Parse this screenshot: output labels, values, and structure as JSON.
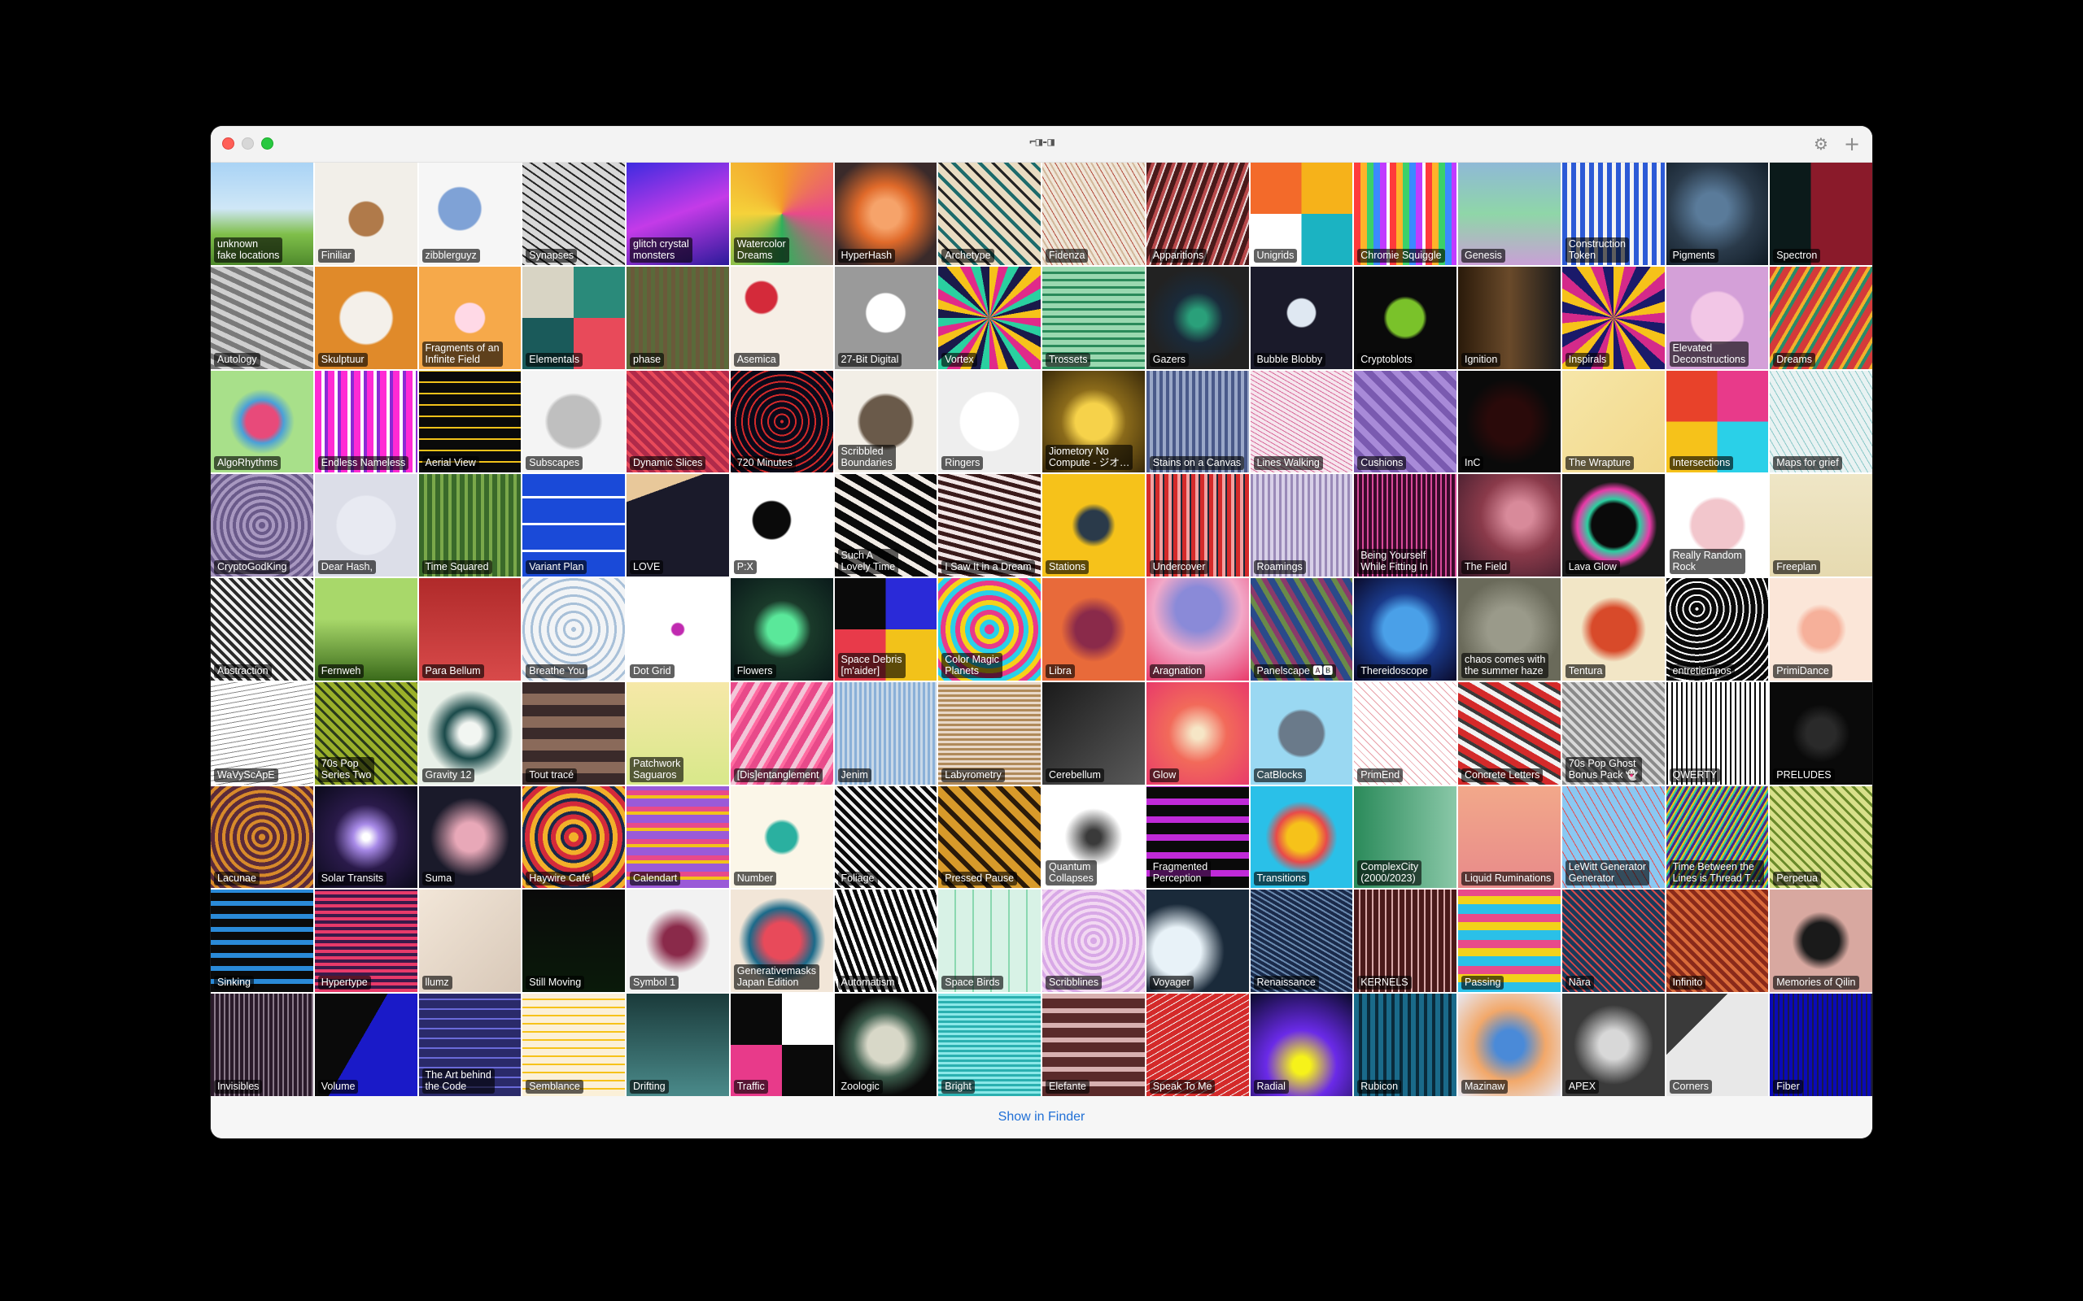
{
  "window": {
    "title_logo": "⌐◨-◨"
  },
  "toolbar": {
    "settings_icon": "⚙",
    "add_icon": "+"
  },
  "footer": {
    "show_in_finder": "Show in Finder"
  },
  "tiles": [
    {
      "label": "unknown\nfake locations",
      "bg": "linear-gradient(180deg,#a9d3f5 0%,#cfe7f7 45%,#7fbf4a 70%,#4f8a2c 100%)"
    },
    {
      "label": "Finiliar",
      "bg": "radial-gradient(circle at 50% 55%,#b07a4a 0 22%,#f2efe9 24%)"
    },
    {
      "label": "zibblerguyz",
      "bg": "radial-gradient(circle at 40% 45%,#7fa2d6 0 25%,#f6f6f6 27%)"
    },
    {
      "label": "Synapses",
      "bg": "repeating-linear-gradient(35deg,#222 0 2px,#d8d8d8 2px 9px)"
    },
    {
      "label": "glitch crystal\nmonsters",
      "bg": "linear-gradient(160deg,#3d2be0,#c43be8 50%,#2a1a9a)"
    },
    {
      "label": "Watercolor\nDreams",
      "bg": "conic-gradient(#f39b2a,#e84a8a,#2fb05a,#f5d23a,#f39b2a)"
    },
    {
      "label": "HyperHash",
      "bg": "radial-gradient(circle,#f6a36a 0 20%,#e06a2a 40%,#3a2a2a 80%)"
    },
    {
      "label": "Archetype",
      "bg": "repeating-linear-gradient(45deg,#e9dcc2 0 8px,#1c6b6b 8px 12px,#e9dcc2 12px 20px,#222 20px 23px)"
    },
    {
      "label": "Fidenza",
      "bg": "repeating-linear-gradient(60deg,#efe6d8 0 4px,#d2b79a 4px 6px,#efe6d8 6px 10px,#b04a3a 10px 11px)"
    },
    {
      "label": "Apparitions",
      "bg": "repeating-linear-gradient(110deg,#4a1a1a 0 6px,#b8484a 6px 10px,#e8d8d8 10px 12px)"
    },
    {
      "label": "Unigrids",
      "bg": "conic-gradient(#f6b21a 0 25%,#1bb3c2 0 50%,#ffffff 0 75%,#f36a2a 0)"
    },
    {
      "label": "Chromie Squiggle",
      "bg": "repeating-linear-gradient(90deg,#ff3b3b 0 8px,#ffb32a 8px 16px,#3bd16a 16px 24px,#3b8aff 24px 32px,#c13bff 32px 40px,#ffffff 40px 44px)"
    },
    {
      "label": "Genesis",
      "bg": "linear-gradient(180deg,#8fb9d6,#8fd6a8 50%,#c9a0d6)"
    },
    {
      "label": "Construction\nToken",
      "bg": "repeating-linear-gradient(90deg,#2c5ad6 0 6px,#f4f4f4 6px 11px)"
    },
    {
      "label": "Pigments",
      "bg": "radial-gradient(circle at 45% 45%,#5a7b9a 0 20%,#2a3a4a 55%,#0f1a24)"
    },
    {
      "label": "Spectron",
      "bg": "linear-gradient(90deg,#0b1a1a 0 40%,#8a1a2a 40%)"
    },
    {
      "label": "Autology",
      "bg": "repeating-linear-gradient(25deg,#7a7a7a 0 6px,#cfcfcf 6px 12px)"
    },
    {
      "label": "Skulptuur",
      "bg": "radial-gradient(circle at 50% 50%,#f4f0ea 0 35%,#e08a2a 38%)"
    },
    {
      "label": "Fragments of an\nInfinite Field",
      "bg": "radial-gradient(circle,#ffd9e6 0 20%,#f6a94a 22%)"
    },
    {
      "label": "Elementals",
      "bg": "conic-gradient(#2a8a7a 0 25%,#e84a5a 0 50%,#1a5a5a 0 75%,#d8d4c4 0)"
    },
    {
      "label": "phase",
      "bg": "repeating-linear-gradient(90deg,#5a6a3a 0 5px,#6a5a3a 5px 10px)"
    },
    {
      "label": "Asemica",
      "bg": "radial-gradient(circle at 30% 30%,#d42a3a 0 15%,#f6efe6 17%)"
    },
    {
      "label": "27-Bit Digital",
      "bg": "radial-gradient(circle at 50% 45%,#ffffff 0 25%,#9a9a9a 27%)"
    },
    {
      "label": "Vortex",
      "bg": "repeating-conic-gradient(#f6c21a 0 10deg,#e02a8a 10deg 20deg,#2ad0a0 20deg 30deg,#1a1a4a 30deg 40deg)"
    },
    {
      "label": "Trossets",
      "bg": "repeating-linear-gradient(0deg,#2a8a5a 0 3px,#9ad8b0 3px 9px)"
    },
    {
      "label": "Gazers",
      "bg": "radial-gradient(circle,#2aa07a 0 12%,#1a2a3a 35%,#222 70%)"
    },
    {
      "label": "Bubble Blobby",
      "bg": "radial-gradient(circle at 50% 45%,#dfe8f2 0 18%,#1a1a2a 20%)"
    },
    {
      "label": "Cryptoblots",
      "bg": "radial-gradient(circle,#7ac22a 0 25%,#0a0a0a 30%)"
    },
    {
      "label": "Ignition",
      "bg": "linear-gradient(90deg,#2a1a0a,#6a4a2a 50%,#1a1a1a)"
    },
    {
      "label": "Inspirals",
      "bg": "repeating-conic-gradient(#f6c21a 0 12deg,#d42a8a 12deg 24deg,#1a1a6a 24deg 36deg)"
    },
    {
      "label": "Elevated\nDeconstructions",
      "bg": "radial-gradient(circle,#f2c6e6 0 35%,#d4a0d8 38%)"
    },
    {
      "label": "Dreams",
      "bg": "repeating-linear-gradient(120deg,#d43a3a 0 8px,#f2b02a 8px 12px,#2a8a6a 12px 16px)"
    },
    {
      "label": "AlgoRhythms",
      "bg": "radial-gradient(circle,#e84a7a 0 22%,#4aa0d8 30%,#a8e08a 45%)"
    },
    {
      "label": "Endless Nameless",
      "bg": "repeating-linear-gradient(90deg,#ff2ad4 0 8px,#ffffff 8px 12px,#8a2ad4 12px 16px)"
    },
    {
      "label": "Aerial View",
      "bg": "repeating-linear-gradient(0deg,#0a0a0a 0 12px,#f2c21a 12px 14px),repeating-linear-gradient(90deg,#0a0a0a 0 12px,#f2c21a 12px 14px)"
    },
    {
      "label": "Subscapes",
      "bg": "radial-gradient(ellipse,#bfbfbf 0 35%,#f4f4f4 40%)"
    },
    {
      "label": "Dynamic Slices",
      "bg": "repeating-linear-gradient(45deg,#b02a4a 0 6px,#e84a5a 6px 10px)"
    },
    {
      "label": "720 Minutes",
      "bg": "repeating-radial-gradient(circle,#d42a2a 0 2px,#0a0a1a 2px 8px)"
    },
    {
      "label": "Scribbled\nBoundaries",
      "bg": "radial-gradient(circle,#6a5a4a 0 35%,#f2eee6 40%)"
    },
    {
      "label": "Ringers",
      "bg": "radial-gradient(circle,#ffffff 0 40%,#eeeeee 42%)"
    },
    {
      "label": "Jiometory No\nCompute - ジオ…",
      "bg": "radial-gradient(circle,#f6d24a 0 25%,#8a6a1a 45%,#3a2a0a)"
    },
    {
      "label": "Stains on a Canvas",
      "bg": "repeating-linear-gradient(90deg,#4a5a8a 0 4px,#9aa8c8 4px 8px)"
    },
    {
      "label": "Lines Walking",
      "bg": "repeating-linear-gradient(30deg,#f6e6ee 0 4px,#d86a9a 4px 5px)"
    },
    {
      "label": "Cushions",
      "bg": "repeating-linear-gradient(45deg,#7a5ab0 0 8px,#a88ad8 8px 16px)"
    },
    {
      "label": "InC",
      "bg": "radial-gradient(circle,#2a0a0a 0 30%,#0a0a0a 60%)"
    },
    {
      "label": "The Wrapture",
      "bg": "linear-gradient(135deg,#f6e6a8,#f2d88a)"
    },
    {
      "label": "Intersections",
      "bg": "conic-gradient(#e83a8a 0 25%,#2ad0e8 0 50%,#f6c21a 0 75%,#e8422a 0)"
    },
    {
      "label": "Maps for grief",
      "bg": "repeating-linear-gradient(60deg,#e8f2f2 0 6px,#8ac8c8 6px 7px)"
    },
    {
      "label": "CryptoGodKing",
      "bg": "repeating-radial-gradient(circle,#6a5a8a 0 4px,#a898c0 4px 8px)"
    },
    {
      "label": "Dear Hash,",
      "bg": "radial-gradient(circle,#e8eaf2 0 40%,#dcdee8 42%)"
    },
    {
      "label": "Time Squared",
      "bg": "repeating-linear-gradient(90deg,#3a6a2a 0 6px,#7aa84a 6px 10px)"
    },
    {
      "label": "Variant Plan",
      "bg": "repeating-linear-gradient(0deg,#1a4ad8 0 30px,#ffffff 30px 33px)"
    },
    {
      "label": "LOVE",
      "bg": "linear-gradient(160deg,#e8c89a 0 20%,#1a1a2a 20%)"
    },
    {
      "label": "P:X",
      "bg": "radial-gradient(circle at 40% 45%,#0a0a0a 0 22%,#ffffff 24%)"
    },
    {
      "label": "Such A\nLovely Time",
      "bg": "repeating-linear-gradient(30deg,#0a0a0a 0 10px,#f2ece6 10px 16px)"
    },
    {
      "label": "I Saw It in a Dream",
      "bg": "repeating-linear-gradient(15deg,#3a1a1a 0 5px,#f2e6e6 5px 10px)"
    },
    {
      "label": "Stations",
      "bg": "radial-gradient(circle,#2a3a4a 0 20%,#f6c21a 30%)"
    },
    {
      "label": "Undercover",
      "bg": "repeating-linear-gradient(90deg,#d42a2a 0 5px,#f2a0a0 5px 9px,#1a2a3a 9px 11px)"
    },
    {
      "label": "Roamings",
      "bg": "repeating-linear-gradient(90deg,#9a8ab8 0 3px,#d8d0e8 3px 7px)"
    },
    {
      "label": "Being Yourself\nWhile Fitting In",
      "bg": "repeating-linear-gradient(90deg,#3a0a2a 0 4px,#d84a9a 4px 6px)"
    },
    {
      "label": "The Field",
      "bg": "radial-gradient(ellipse at 60% 40%,#d88a9a 0 15%,#8a3a4a 45%,#3a1a2a)"
    },
    {
      "label": "Lava Glow",
      "bg": "radial-gradient(circle,#0a0a0a 0 30%,#2ad0a0 36%,#e83aa8 50%,#1a1a1a 60%)"
    },
    {
      "label": "Really Random\nRock",
      "bg": "radial-gradient(circle,#f2c6cc 0 35%,#ffffff 40%)"
    },
    {
      "label": "Freeplan",
      "bg": "linear-gradient(180deg,#efe6c6,#e6dab0)"
    },
    {
      "label": "Abstraction",
      "bg": "repeating-linear-gradient(45deg,#2a2a2a 0 4px,#f2f2f2 4px 8px)"
    },
    {
      "label": "Fernweh",
      "bg": "linear-gradient(180deg,#a8d86a 0 40%,#3a6a1a 100%)"
    },
    {
      "label": "Para Bellum",
      "bg": "linear-gradient(180deg,#b02a2a,#d84a4a)"
    },
    {
      "label": "Breathe You",
      "bg": "repeating-radial-gradient(circle,#a8c0d8 0 3px,#f2f4f6 3px 10px)"
    },
    {
      "label": "Dot Grid",
      "bg": "radial-gradient(circle,#c02ab0 0 8%,#ffffff 10%)"
    },
    {
      "label": "Flowers",
      "bg": "radial-gradient(circle,#5ae89a 0 20%,#1a3a2a 40%,#0a1a1a)"
    },
    {
      "label": "Space Debris\n[m'aider]",
      "bg": "conic-gradient(#2a2ad8 0 25%,#f2c21a 0 50%,#e83a4a 0 75%,#0a0a0a 0)"
    },
    {
      "label": "Color Magic\nPlanets",
      "bg": "repeating-radial-gradient(circle,#e83a8a 0 6px,#2ad0e8 6px 12px,#f6d21a 12px 18px)"
    },
    {
      "label": "Libra",
      "bg": "radial-gradient(circle,#8a2a4a 0 25%,#e86a3a 45%)"
    },
    {
      "label": "Aragnation",
      "bg": "radial-gradient(circle at 50% 30%,#8a8ad8 0 25%,#f2a8c8 50%,#e83a6a)"
    },
    {
      "label": "Panelscape 🅰🅱",
      "bg": "repeating-linear-gradient(60deg,#2a4a8a 0 8px,#6a8a4a 8px 14px,#8a3a6a 14px 20px)"
    },
    {
      "label": "Thereidoscope",
      "bg": "radial-gradient(circle,#4aa0e8 0 30%,#1a3a8a 50%,#0a0a2a)"
    },
    {
      "label": "chaos comes with\nthe summer haze",
      "bg": "radial-gradient(circle,#9a9a8a 0 30%,#6a6a5a 70%)"
    },
    {
      "label": "Tentura",
      "bg": "radial-gradient(circle,#d84a2a 0 30%,#f2e6c6 45%)"
    },
    {
      "label": "entretiempos",
      "bg": "repeating-radial-gradient(circle at 30% 30%,#ffffff 0 2px,#0a0a0a 2px 8px)"
    },
    {
      "label": "PrimiDance",
      "bg": "radial-gradient(circle,#f6b09a 0 25%,#fbe6d8 35%)"
    },
    {
      "label": "WaVyScApE",
      "bg": "repeating-linear-gradient(170deg,#ffffff 0 5px,#8a8a8a 5px 6px)"
    },
    {
      "label": "70s Pop\nSeries Two",
      "bg": "repeating-linear-gradient(45deg,#9ab02a 0 6px,#2a3a1a 6px 9px)"
    },
    {
      "label": "Gravity 12",
      "bg": "radial-gradient(circle,#f2f6f2 0 15%,#1a4a4a 35%,#e8f0e8 60%)"
    },
    {
      "label": "Tout tracé",
      "bg": "repeating-linear-gradient(0deg,#3a2a2a 0 14px,#8a6a5a 14px 28px),repeating-linear-gradient(90deg,#6a4a3a 0 14px,#b08a7a 14px 28px)"
    },
    {
      "label": "Patchwork\nSaguaros",
      "bg": "linear-gradient(180deg,#f6e8a8,#d8e88a)"
    },
    {
      "label": "[Dis]entanglement",
      "bg": "repeating-linear-gradient(120deg,#e84a8a 0 8px,#f2c6d8 8px 14px,#ff6aa0 14px 18px)"
    },
    {
      "label": "Jenim",
      "bg": "repeating-linear-gradient(90deg,#8ab0d8 0 3px,#c8d8e8 3px 6px)"
    },
    {
      "label": "Labyrometry",
      "bg": "repeating-linear-gradient(0deg,#b08a5a 0 3px,#e8d8c8 3px 6px)"
    },
    {
      "label": "Cerebellum",
      "bg": "linear-gradient(135deg,#1a1a1a,#5a5a5a)"
    },
    {
      "label": "Glow",
      "bg": "radial-gradient(circle,#f6e6c6 0 8%,#f26a5a 40%,#e83a6a)"
    },
    {
      "label": "CatBlocks",
      "bg": "radial-gradient(circle,#6a7a8a 0 30%,#9ad8f2 34%)"
    },
    {
      "label": "PrimEnd",
      "bg": "repeating-linear-gradient(45deg,#ffffff 0 6px,#e8a0a8 6px 7px)"
    },
    {
      "label": "Concrete Letters",
      "bg": "repeating-linear-gradient(30deg,#d42a2a 0 8px,#f2f2f2 8px 14px,#3a3a3a 14px 18px)"
    },
    {
      "label": "70s Pop Ghost\nBonus Pack 👻",
      "bg": "repeating-linear-gradient(45deg,#8a8a8a 0 4px,#d8d8d8 4px 8px)"
    },
    {
      "label": "QWERTY",
      "bg": "repeating-linear-gradient(90deg,#0a0a0a 0 2px,#ffffff 2px 6px)"
    },
    {
      "label": "PRELUDES",
      "bg": "radial-gradient(circle,#2a2a2a 0 20%,#0a0a0a 40%)"
    },
    {
      "label": "Lacunae",
      "bg": "repeating-radial-gradient(circle,#d88a2a 0 4px,#5a2a3a 4px 9px)"
    },
    {
      "label": "Solar Transits",
      "bg": "radial-gradient(circle,#ffffff 0 5%,#a88ae8 18%,#2a1a4a 45%,#0a0a1a)"
    },
    {
      "label": "Suma",
      "bg": "radial-gradient(ellipse,#e8a8b8 0 20%,#1a1a2a 55%)"
    },
    {
      "label": "Haywire Café",
      "bg": "repeating-radial-gradient(circle,#f2b02a 0 6px,#d42a3a 6px 12px,#1a2a4a 12px 16px)"
    },
    {
      "label": "Calendart",
      "bg": "repeating-linear-gradient(0deg,#9a5ad8 0 10px,#f2c21a 10px 14px,#e84a8a 14px 20px)"
    },
    {
      "label": "Number",
      "bg": "radial-gradient(circle,#2ab0a0 0 20%,#fbf6e8 25%)"
    },
    {
      "label": "Foliage",
      "bg": "repeating-linear-gradient(45deg,#0a0a0a 0 5px,#f2f2f2 5px 9px)"
    },
    {
      "label": "Pressed Pause",
      "bg": "repeating-linear-gradient(45deg,#d89a2a 0 10px,#2a1a0a 10px 16px)"
    },
    {
      "label": "Quantum\nCollapses",
      "bg": "radial-gradient(circle,#3a3a3a 0 10%,#ffffff 40%)"
    },
    {
      "label": "Fragmented\nPerception",
      "bg": "repeating-linear-gradient(0deg,#0a0a0a 0 14px,#c02ad8 14px 22px)"
    },
    {
      "label": "Transitions",
      "bg": "radial-gradient(circle,#f6c21a 0 20%,#e84a4a 35%,#2ac0e8 50%)"
    },
    {
      "label": "ComplexCity\n(2000/2023)",
      "bg": "linear-gradient(90deg,#2a8a5a,#8ac8a8)"
    },
    {
      "label": "Liquid Ruminations",
      "bg": "linear-gradient(180deg,#f2a88a,#e88a8a)"
    },
    {
      "label": "LeWitt Generator\nGenerator",
      "bg": "repeating-linear-gradient(60deg,#8ac8f2 0 4px,#e84a4a 4px 5px,#8ac8f2 5px 9px)"
    },
    {
      "label": "Time Between the\nLines is Thread T…",
      "bg": "repeating-linear-gradient(120deg,#4a2a8a 0 3px,#f2c21a 3px 5px,#2ad0a0 5px 7px)"
    },
    {
      "label": "Perpetua",
      "bg": "repeating-linear-gradient(45deg,#d8e08a 0 6px,#6a8a2a 6px 9px)"
    },
    {
      "label": "Sinking",
      "bg": "repeating-linear-gradient(0deg,#0a0a0a 0 10px,#2a8ad8 10px 16px)"
    },
    {
      "label": "Hypertype",
      "bg": "repeating-linear-gradient(0deg,#e83a6a 0 4px,#3a1a4a 4px 8px)"
    },
    {
      "label": "llumz",
      "bg": "linear-gradient(135deg,#f2e6d8,#d8c8b8)"
    },
    {
      "label": "Still Moving",
      "bg": "linear-gradient(180deg,#0a0a0a,#0a1a0a)"
    },
    {
      "label": "Symbol 1",
      "bg": "radial-gradient(circle,#8a2a4a 0 20%,#f2f2f2 45%)"
    },
    {
      "label": "Generativemasks\nJapan Edition",
      "bg": "radial-gradient(circle,#e84a5a 0 25%,#1a6a8a 45%,#f2e6d8 60%)"
    },
    {
      "label": "Automatism",
      "bg": "repeating-linear-gradient(70deg,#0a0a0a 0 5px,#ffffff 5px 9px)"
    },
    {
      "label": "Space Birds",
      "bg": "repeating-linear-gradient(90deg,#d8f2e6 0 20px,#8ad8b0 20px 22px)"
    },
    {
      "label": "Scribblines",
      "bg": "repeating-radial-gradient(circle,#d8a8e6 0 4px,#f2d8f2 4px 8px)"
    },
    {
      "label": "Voyager",
      "bg": "radial-gradient(circle at 30% 60%,#e8f2f8 0 25%,#1a2a3a 50%)"
    },
    {
      "label": "Renaissance",
      "bg": "repeating-linear-gradient(30deg,#1a2a4a 0 4px,#6a8ab0 4px 6px)"
    },
    {
      "label": "KERNELS",
      "bg": "repeating-linear-gradient(90deg,#4a1a1a 0 6px,#d8a8a8 6px 8px)"
    },
    {
      "label": "Passing",
      "bg": "repeating-linear-gradient(0deg,#2ac0e8 0 12px,#f2d21a 12px 22px,#e84a8a 22px 32px)"
    },
    {
      "label": "Nāra",
      "bg": "repeating-linear-gradient(45deg,#1a3a5a 0 5px,#d84a4a 5px 7px)"
    },
    {
      "label": "Infinito",
      "bg": "repeating-linear-gradient(45deg,#8a2a1a 0 5px,#d86a3a 5px 9px)"
    },
    {
      "label": "Memories of Qilin",
      "bg": "radial-gradient(circle,#1a1a1a 0 25%,#d8a8a0 40%)"
    },
    {
      "label": "Invisibles",
      "bg": "repeating-linear-gradient(90deg,#2a1a2a 0 4px,#8a7a8a 4px 6px)"
    },
    {
      "label": "Volume",
      "bg": "linear-gradient(120deg,#0a0a0a 0 45%,#1a1ac8 45%)"
    },
    {
      "label": "The Art behind\nthe Code",
      "bg": "repeating-linear-gradient(0deg,#2a2a6a 0 10px,#6a6ad8 10px 12px)"
    },
    {
      "label": "Semblance",
      "bg": "repeating-linear-gradient(0deg,#fbf0d8 0 8px,#f6c21a 8px 10px)"
    },
    {
      "label": "Drifting",
      "bg": "linear-gradient(180deg,#1a3a3a,#4a8a8a)"
    },
    {
      "label": "Traffic",
      "bg": "conic-gradient(#ffffff 0 25%,#0a0a0a 0 50%,#e83a8a 0 75%,#0a0a0a 0)"
    },
    {
      "label": "Zoologic",
      "bg": "radial-gradient(circle,#d8d8c8 0 25%,#3a5a4a 45%,#0a0a0a 70%)"
    },
    {
      "label": "Bright",
      "bg": "repeating-linear-gradient(0deg,#2ab0b0 0 3px,#8ae8e8 3px 6px)"
    },
    {
      "label": "Elefante",
      "bg": "repeating-linear-gradient(0deg,#5a2a2a 0 12px,#d8b0b0 12px 18px)"
    },
    {
      "label": "Speak To Me",
      "bg": "repeating-linear-gradient(150deg,#d42a2a 0 6px,#f2f2f2 6px 7px)"
    },
    {
      "label": "Radial",
      "bg": "radial-gradient(circle at 50% 70%,#f6f21a 0 10%,#6a2ae8 40%,#0a0a2a)"
    },
    {
      "label": "Rubicon",
      "bg": "repeating-linear-gradient(90deg,#1a6a8a 0 6px,#0a2a3a 6px 10px)"
    },
    {
      "label": "Mazinaw",
      "bg": "radial-gradient(circle,#4a8ad8 0 20%,#f2a86a 50%,#e8e8f2)"
    },
    {
      "label": "APEX",
      "bg": "radial-gradient(circle,#d8d8d8 0 20%,#3a3a3a 55%)"
    },
    {
      "label": "Corners",
      "bg": "linear-gradient(135deg,#3a3a3a 0 30%,#e8e8e8 30%)"
    },
    {
      "label": "Fiber",
      "bg": "repeating-linear-gradient(90deg,#0a0ab8 0 4px,#1a1a4a 4px 6px)"
    }
  ]
}
